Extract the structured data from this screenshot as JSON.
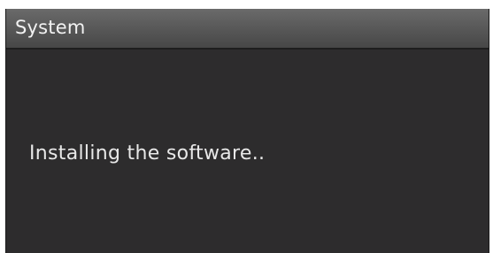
{
  "dialog": {
    "title": "System",
    "message": "Installing the software.."
  },
  "colors": {
    "background": "#2d2c2d",
    "titlebar": "#5a5a5a",
    "text": "#e8e8e8"
  }
}
